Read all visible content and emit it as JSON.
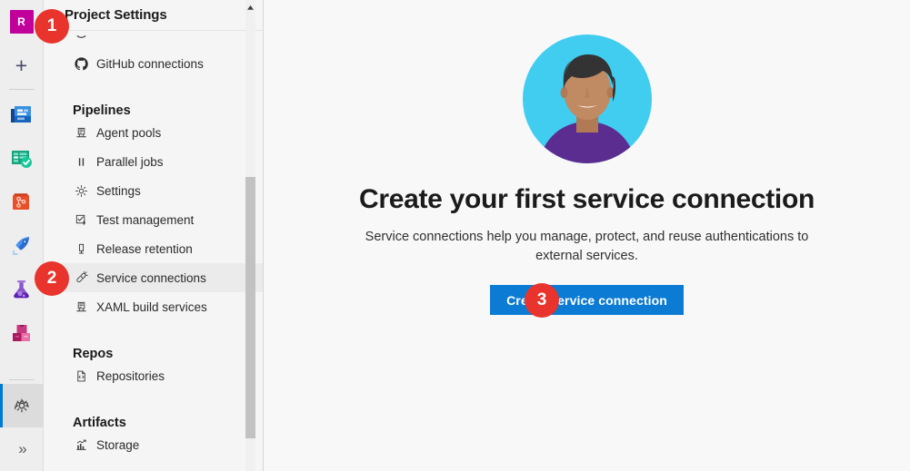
{
  "rail": {
    "project_initial": "R",
    "items": [
      {
        "name": "project-avatar",
        "label": "R",
        "icon": "project-initial-badge"
      },
      {
        "name": "new-item",
        "label": "New",
        "icon": "plus-icon"
      },
      {
        "name": "boards",
        "label": "Boards",
        "icon": "boards-icon"
      },
      {
        "name": "test-plans-overview",
        "label": "Test Plans",
        "icon": "test-plans-check-icon"
      },
      {
        "name": "repos",
        "label": "Repos",
        "icon": "repos-icon"
      },
      {
        "name": "pipelines",
        "label": "Pipelines",
        "icon": "pipelines-rocket-icon"
      },
      {
        "name": "test-flask",
        "label": "Test Plans",
        "icon": "flask-icon"
      },
      {
        "name": "artifacts",
        "label": "Artifacts",
        "icon": "artifacts-boxes-icon"
      },
      {
        "name": "project-settings",
        "label": "Project settings",
        "icon": "gear-icon"
      },
      {
        "name": "expand",
        "label": "Expand",
        "icon": "double-chevron-right-icon"
      }
    ]
  },
  "nav": {
    "title": "Project Settings",
    "partial_item_above": "",
    "groups": [
      {
        "title": "",
        "items": [
          {
            "label": "GitHub connections",
            "icon": "github-icon",
            "active": false
          }
        ]
      },
      {
        "title": "Pipelines",
        "items": [
          {
            "label": "Agent pools",
            "icon": "agent-pool-icon",
            "active": false
          },
          {
            "label": "Parallel jobs",
            "icon": "parallel-jobs-icon",
            "active": false
          },
          {
            "label": "Settings",
            "icon": "gear-icon",
            "active": false
          },
          {
            "label": "Test management",
            "icon": "test-management-icon",
            "active": false
          },
          {
            "label": "Release retention",
            "icon": "release-retention-icon",
            "active": false
          },
          {
            "label": "Service connections",
            "icon": "service-connections-icon",
            "active": true
          },
          {
            "label": "XAML build services",
            "icon": "xaml-build-icon",
            "active": false
          }
        ]
      },
      {
        "title": "Repos",
        "items": [
          {
            "label": "Repositories",
            "icon": "repositories-icon",
            "active": false
          }
        ]
      },
      {
        "title": "Artifacts",
        "items": [
          {
            "label": "Storage",
            "icon": "storage-chart-icon",
            "active": false
          }
        ]
      }
    ],
    "scroll_up_label": "Scroll up"
  },
  "main": {
    "avatar_alt": "person-illustration",
    "title": "Create your first service connection",
    "subtitle": "Service connections help you manage, protect, and reuse authentications to external services.",
    "cta_label": "Create service connection"
  },
  "callouts": [
    {
      "id": "1",
      "target": "project-settings-header"
    },
    {
      "id": "2",
      "target": "service-connections-nav-item"
    },
    {
      "id": "3",
      "target": "create-service-connection-button"
    }
  ],
  "colors": {
    "accent_blue": "#0b7bd4",
    "callout_red": "#e8342c",
    "project_badge": "#c1009c",
    "avatar_bg": "#41cdf0",
    "avatar_skin": "#c08a62",
    "avatar_hair": "#333333",
    "avatar_shirt": "#5b2d91",
    "nav_bg": "#f5f5f5",
    "main_bg": "#f8f8f8",
    "rail_bg": "#eeeeee"
  }
}
